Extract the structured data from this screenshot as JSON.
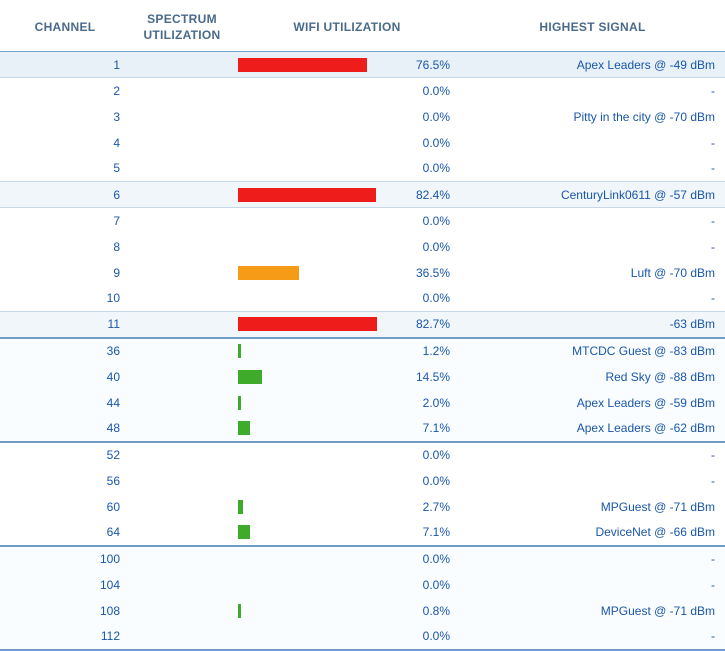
{
  "headers": {
    "channel": "CHANNEL",
    "spectrum": "SPECTRUM UTILIZATION",
    "wifi": "WIFI UTILIZATION",
    "signal": "HIGHEST SIGNAL"
  },
  "colors": {
    "red": "#ef1c1c",
    "orange": "#f59b18",
    "green": "#3fab2a"
  },
  "groups": [
    {
      "rows": [
        {
          "channel": "1",
          "wifi_pct": "76.5%",
          "bar": 76.5,
          "color": "red",
          "signal": "Apex Leaders @ -49 dBm",
          "shade": "highlight",
          "sep": "thin"
        },
        {
          "channel": "2",
          "wifi_pct": "0.0%",
          "bar": 0,
          "color": null,
          "signal": "-",
          "shade": "none"
        },
        {
          "channel": "3",
          "wifi_pct": "0.0%",
          "bar": 0,
          "color": null,
          "signal": "Pitty in the city @ -70 dBm",
          "shade": "none"
        },
        {
          "channel": "4",
          "wifi_pct": "0.0%",
          "bar": 0,
          "color": null,
          "signal": "-",
          "shade": "none"
        },
        {
          "channel": "5",
          "wifi_pct": "0.0%",
          "bar": 0,
          "color": null,
          "signal": "-",
          "shade": "none",
          "sep": "thin"
        },
        {
          "channel": "6",
          "wifi_pct": "82.4%",
          "bar": 82.4,
          "color": "red",
          "signal": "CenturyLink0611 @ -57 dBm",
          "shade": "mid",
          "sep": "thin"
        },
        {
          "channel": "7",
          "wifi_pct": "0.0%",
          "bar": 0,
          "color": null,
          "signal": "-",
          "shade": "none"
        },
        {
          "channel": "8",
          "wifi_pct": "0.0%",
          "bar": 0,
          "color": null,
          "signal": "-",
          "shade": "none"
        },
        {
          "channel": "9",
          "wifi_pct": "36.5%",
          "bar": 36.5,
          "color": "orange",
          "signal": "Luft @ -70 dBm",
          "shade": "none"
        },
        {
          "channel": "10",
          "wifi_pct": "0.0%",
          "bar": 0,
          "color": null,
          "signal": "-",
          "shade": "none",
          "sep": "thin"
        },
        {
          "channel": "11",
          "wifi_pct": "82.7%",
          "bar": 82.7,
          "color": "red",
          "signal": "-63 dBm",
          "shade": "mid",
          "sep": "group"
        }
      ]
    },
    {
      "rows": [
        {
          "channel": "36",
          "wifi_pct": "1.2%",
          "bar": 1.2,
          "color": "green",
          "signal": "MTCDC Guest @ -83 dBm",
          "shade": "light"
        },
        {
          "channel": "40",
          "wifi_pct": "14.5%",
          "bar": 14.5,
          "color": "green",
          "signal": "Red Sky @ -88 dBm",
          "shade": "light"
        },
        {
          "channel": "44",
          "wifi_pct": "2.0%",
          "bar": 2.0,
          "color": "green",
          "signal": "Apex Leaders @ -59 dBm",
          "shade": "light"
        },
        {
          "channel": "48",
          "wifi_pct": "7.1%",
          "bar": 7.1,
          "color": "green",
          "signal": "Apex Leaders @ -62 dBm",
          "shade": "light",
          "sep": "group"
        }
      ]
    },
    {
      "rows": [
        {
          "channel": "52",
          "wifi_pct": "0.0%",
          "bar": 0,
          "color": null,
          "signal": "-",
          "shade": "none"
        },
        {
          "channel": "56",
          "wifi_pct": "0.0%",
          "bar": 0,
          "color": null,
          "signal": "-",
          "shade": "none"
        },
        {
          "channel": "60",
          "wifi_pct": "2.7%",
          "bar": 2.7,
          "color": "green",
          "signal": "MPGuest @ -71 dBm",
          "shade": "none"
        },
        {
          "channel": "64",
          "wifi_pct": "7.1%",
          "bar": 7.1,
          "color": "green",
          "signal": "DeviceNet @ -66 dBm",
          "shade": "none",
          "sep": "group"
        }
      ]
    },
    {
      "rows": [
        {
          "channel": "100",
          "wifi_pct": "0.0%",
          "bar": 0,
          "color": null,
          "signal": "-",
          "shade": "light"
        },
        {
          "channel": "104",
          "wifi_pct": "0.0%",
          "bar": 0,
          "color": null,
          "signal": "-",
          "shade": "light"
        },
        {
          "channel": "108",
          "wifi_pct": "0.8%",
          "bar": 0.8,
          "color": "green",
          "signal": "MPGuest @ -71 dBm",
          "shade": "light"
        },
        {
          "channel": "112",
          "wifi_pct": "0.0%",
          "bar": 0,
          "color": null,
          "signal": "-",
          "shade": "light",
          "sep": "group"
        }
      ]
    }
  ]
}
